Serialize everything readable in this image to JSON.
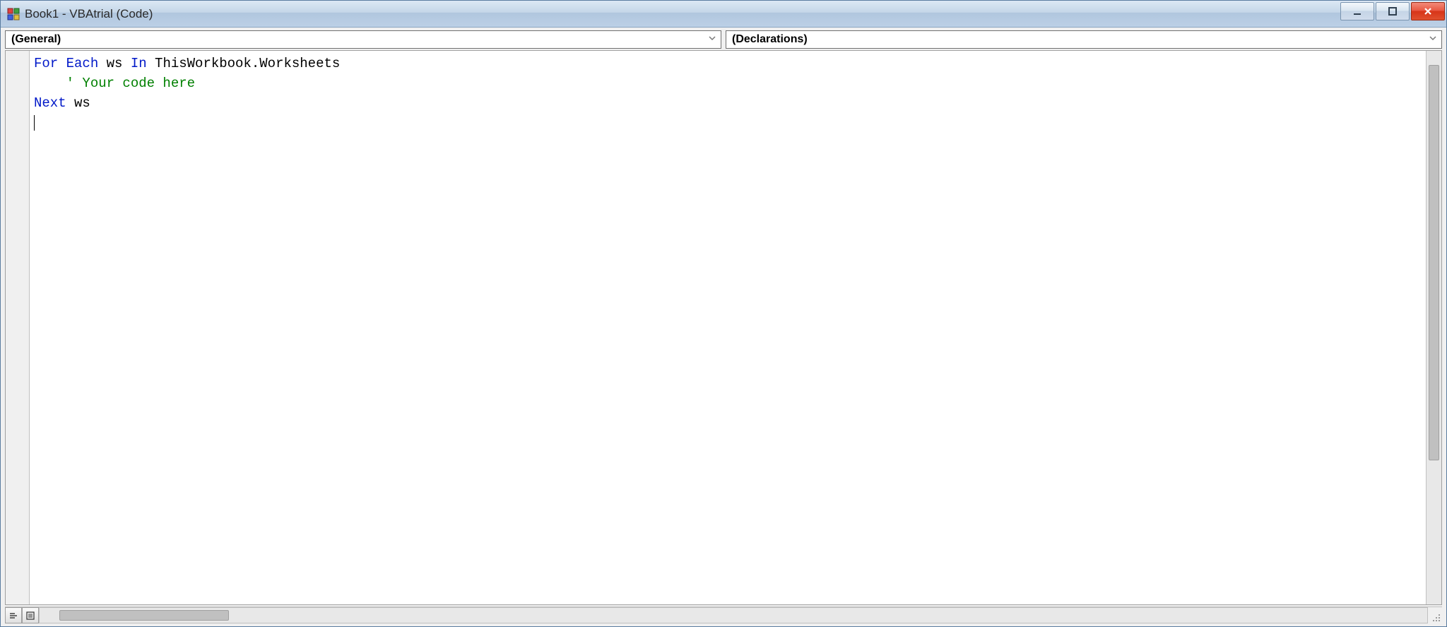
{
  "window": {
    "title": "Book1 - VBAtrial (Code)"
  },
  "dropdowns": {
    "object": "(General)",
    "procedure": "(Declarations)"
  },
  "code": {
    "tokens": [
      [
        {
          "t": "For Each",
          "c": "kw"
        },
        {
          "t": " ws ",
          "c": ""
        },
        {
          "t": "In",
          "c": "kw"
        },
        {
          "t": " ThisWorkbook.Worksheets",
          "c": ""
        }
      ],
      [
        {
          "t": "    ' Your code here",
          "c": "cm"
        }
      ],
      [
        {
          "t": "Next",
          "c": "kw"
        },
        {
          "t": " ws",
          "c": ""
        }
      ],
      []
    ]
  },
  "colors": {
    "keyword": "#0018c8",
    "comment": "#008000",
    "titlebar_start": "#dce8f4",
    "titlebar_end": "#bcd0e6",
    "close_red": "#d63418"
  }
}
